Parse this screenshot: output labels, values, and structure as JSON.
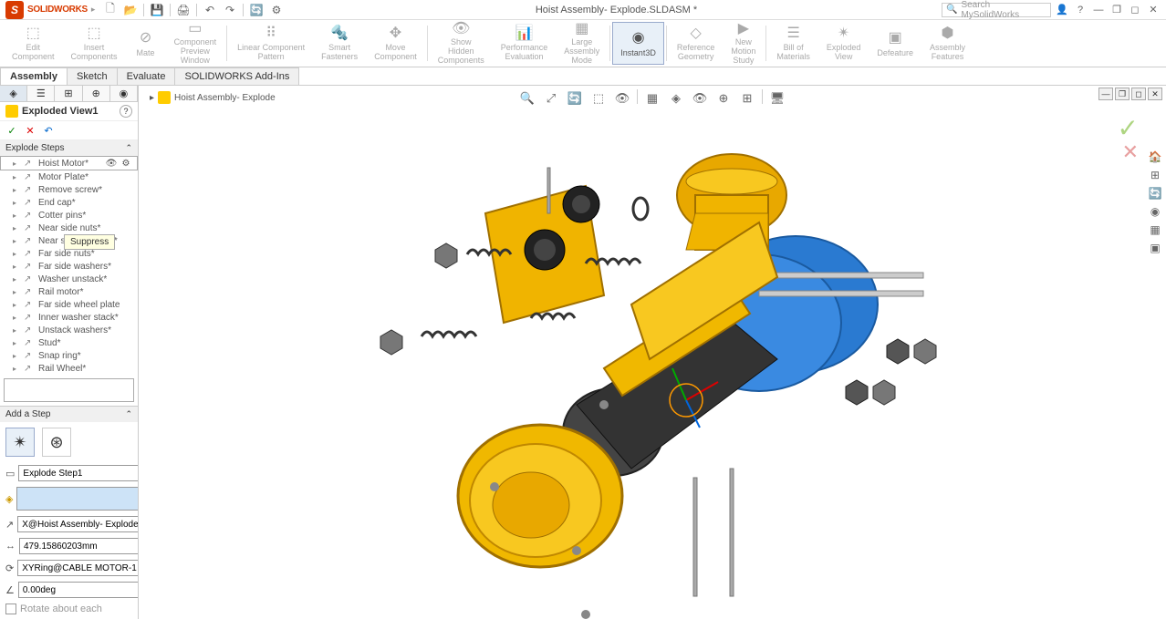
{
  "title": "Hoist Assembly- Explode.SLDASM *",
  "app": {
    "brand": "SOLIDWORKS",
    "logo_char": "S"
  },
  "search": {
    "placeholder": "Search MySolidWorks"
  },
  "ribbon": [
    {
      "label": "Edit\nComponent",
      "icon": "⬚"
    },
    {
      "label": "Insert\nComponents",
      "icon": "⬚"
    },
    {
      "label": "Mate",
      "icon": "⊘"
    },
    {
      "label": "Component\nPreview\nWindow",
      "icon": "▭"
    },
    {
      "label": "Linear Component\nPattern",
      "icon": "⠿"
    },
    {
      "label": "Smart\nFasteners",
      "icon": "🔩"
    },
    {
      "label": "Move\nComponent",
      "icon": "✥"
    },
    {
      "label": "Show\nHidden\nComponents",
      "icon": "👁"
    },
    {
      "label": "Performance\nEvaluation",
      "icon": "📊"
    },
    {
      "label": "Large\nAssembly\nMode",
      "icon": "▦"
    },
    {
      "label": "Instant3D",
      "icon": "◉",
      "active": true
    },
    {
      "label": "Reference\nGeometry",
      "icon": "◇"
    },
    {
      "label": "New\nMotion\nStudy",
      "icon": "▶"
    },
    {
      "label": "Bill of\nMaterials",
      "icon": "☰"
    },
    {
      "label": "Exploded\nView",
      "icon": "✴"
    },
    {
      "label": "Defeature",
      "icon": "▣"
    },
    {
      "label": "Assembly\nFeatures",
      "icon": "⬢"
    }
  ],
  "tabs": [
    "Assembly",
    "Sketch",
    "Evaluate",
    "SOLIDWORKS Add-Ins"
  ],
  "active_tab": "Assembly",
  "breadcrumb": "Hoist Assembly- Explode",
  "feature": {
    "name": "Exploded View1",
    "section1": "Explode Steps",
    "steps": [
      "Hoist Motor*",
      "Motor Plate*",
      "Remove screw*",
      "End cap*",
      "Cotter pins*",
      "Near side nuts*",
      "Near side washers*",
      "Far side nuts*",
      "Far side washers*",
      "Washer unstack*",
      "Rail motor*",
      "Far side wheel plate",
      "Inner washer stack*",
      "Unstack washers*",
      "Stud*",
      "Snap ring*",
      "Rail Wheel*"
    ],
    "tooltip": "Suppress",
    "hovered_index": 0,
    "tooltip_near_index": 5,
    "section2": "Add a Step",
    "stepname": "Explode Step1",
    "component_blank": "",
    "direction": "X@Hoist Assembly- Explode.S",
    "distance": "479.15860203mm",
    "rotaxis": "XYRing@CABLE MOTOR-1",
    "angle": "0.00deg",
    "rotate_each": "Rotate about each"
  },
  "vp_tools": [
    "🔍",
    "⤢",
    "🔄",
    "⬚",
    "👁",
    "|",
    "▦",
    "◈",
    "👁",
    "⊕",
    "⊞",
    "|",
    "🖥"
  ],
  "right_icons": [
    "🏠",
    "⊞",
    "🔄",
    "◉",
    "▦",
    "▣"
  ]
}
